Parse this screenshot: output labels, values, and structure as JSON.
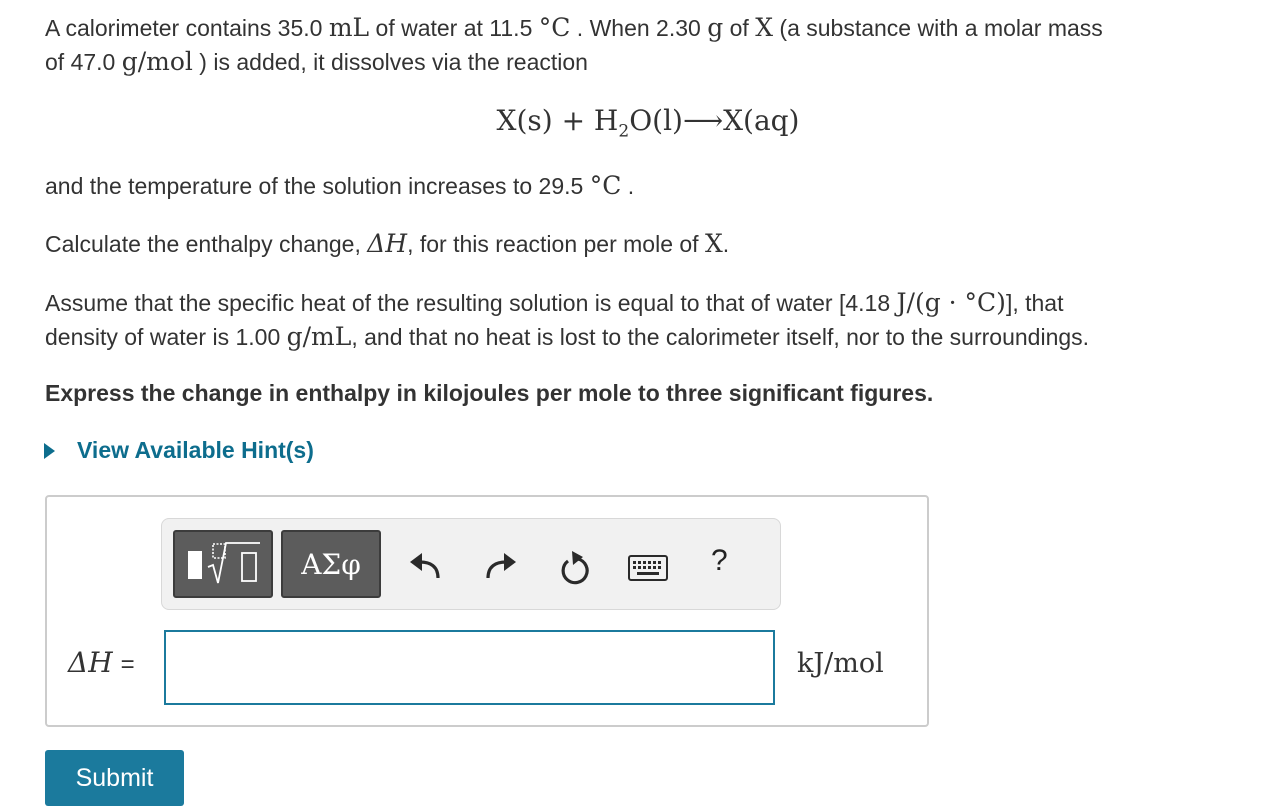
{
  "problem": {
    "line1": {
      "a": "A calorimeter contains 35.0 ",
      "b": "mL",
      "c": " of water at 11.5 ",
      "d": "°C",
      "e": " . When 2.30 ",
      "f": "g",
      "g": " of ",
      "h": "X",
      "i": " (a substance with a molar mass"
    },
    "line2": {
      "a": "of 47.0 ",
      "b": "g/mol",
      "c": " ) is added, it dissolves via the reaction"
    },
    "equation": {
      "left": "X(s) + H",
      "sub": "2",
      "right": "O(l)⟶X(aq)"
    },
    "line3": {
      "a": "and the temperature of the solution increases to 29.5 ",
      "b": "°C",
      "c": " ."
    },
    "line4": {
      "a": "Calculate the enthalpy change, ",
      "b": "ΔH",
      "c": ", for this reaction per mole of ",
      "d": "X",
      "e": "."
    },
    "line5": {
      "a": "Assume that the specific heat of the resulting solution is equal to that of water [4.18 ",
      "b": "J/(g · °C)",
      "c": "],  that"
    },
    "line6": {
      "a": "density of water is 1.00 ",
      "b": "g/mL",
      "c": ", and that no heat is lost to the calorimeter itself, nor to the surroundings."
    },
    "instruction": "Express the change in enthalpy in kilojoules per mole to three significant figures."
  },
  "hint": {
    "label": "View Available Hint(s)"
  },
  "toolbar": {
    "greek_label": "ΑΣφ",
    "help_label": "?"
  },
  "answer": {
    "label": "ΔH",
    "equals": "=",
    "value": "",
    "units": "kJ/mol"
  },
  "submit": {
    "label": "Submit"
  },
  "colors": {
    "accent": "#1b7a9d",
    "hint": "#0d6d8d",
    "text": "#333333",
    "toolbar_button": "#5c5c5c"
  },
  "icons": [
    "templates-icon",
    "greek-letters-icon",
    "undo-icon",
    "redo-icon",
    "reset-icon",
    "keyboard-icon",
    "help-icon"
  ]
}
